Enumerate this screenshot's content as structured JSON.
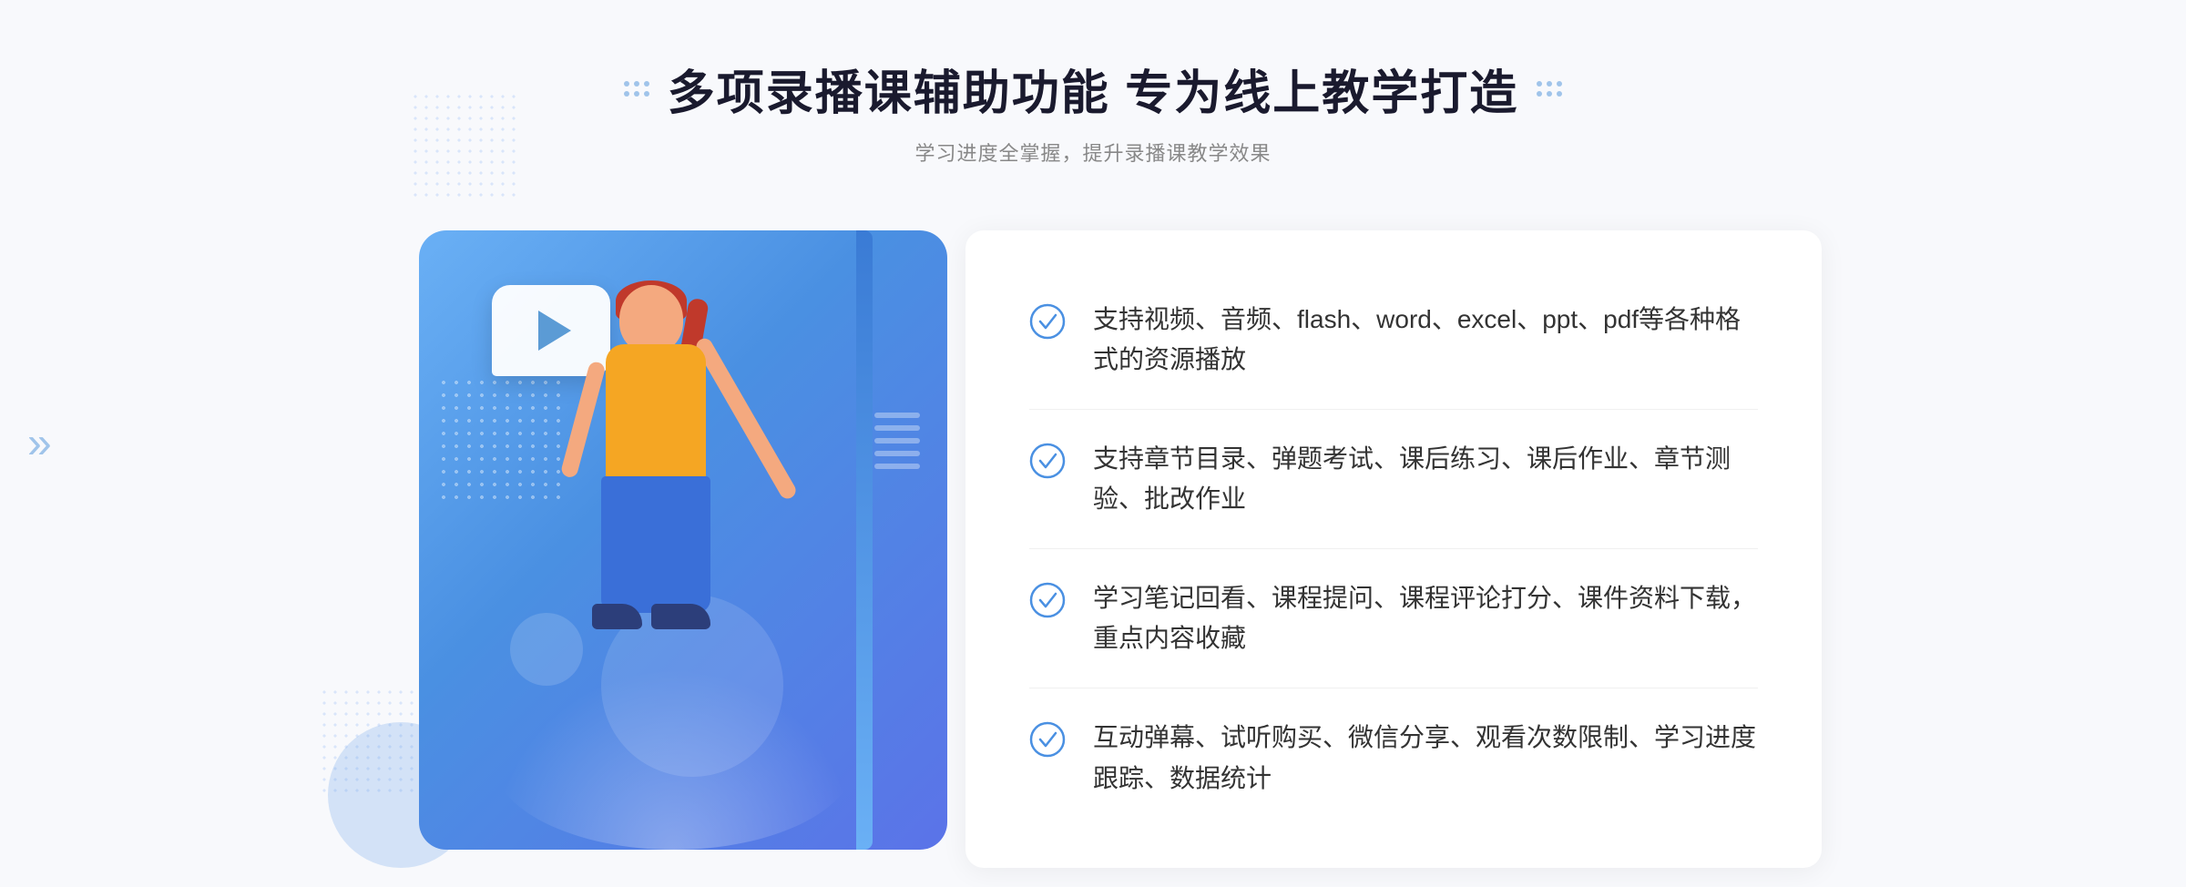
{
  "page": {
    "background": "#f8f9fc"
  },
  "header": {
    "title": "多项录播课辅助功能 专为线上教学打造",
    "subtitle": "学习进度全掌握，提升录播课教学效果"
  },
  "features": [
    {
      "id": "feature-1",
      "text": "支持视频、音频、flash、word、excel、ppt、pdf等各种格式的资源播放"
    },
    {
      "id": "feature-2",
      "text": "支持章节目录、弹题考试、课后练习、课后作业、章节测验、批改作业"
    },
    {
      "id": "feature-3",
      "text": "学习笔记回看、课程提问、课程评论打分、课件资料下载，重点内容收藏"
    },
    {
      "id": "feature-4",
      "text": "互动弹幕、试听购买、微信分享、观看次数限制、学习进度跟踪、数据统计"
    }
  ],
  "icons": {
    "check": "check-circle",
    "play": "play-triangle",
    "chevron_left": "«"
  },
  "colors": {
    "primary": "#4a90e2",
    "accent": "#5b73e8",
    "text_dark": "#1a1a2e",
    "text_gray": "#888888",
    "feature_text": "#333333",
    "check_color": "#4a90e2"
  }
}
